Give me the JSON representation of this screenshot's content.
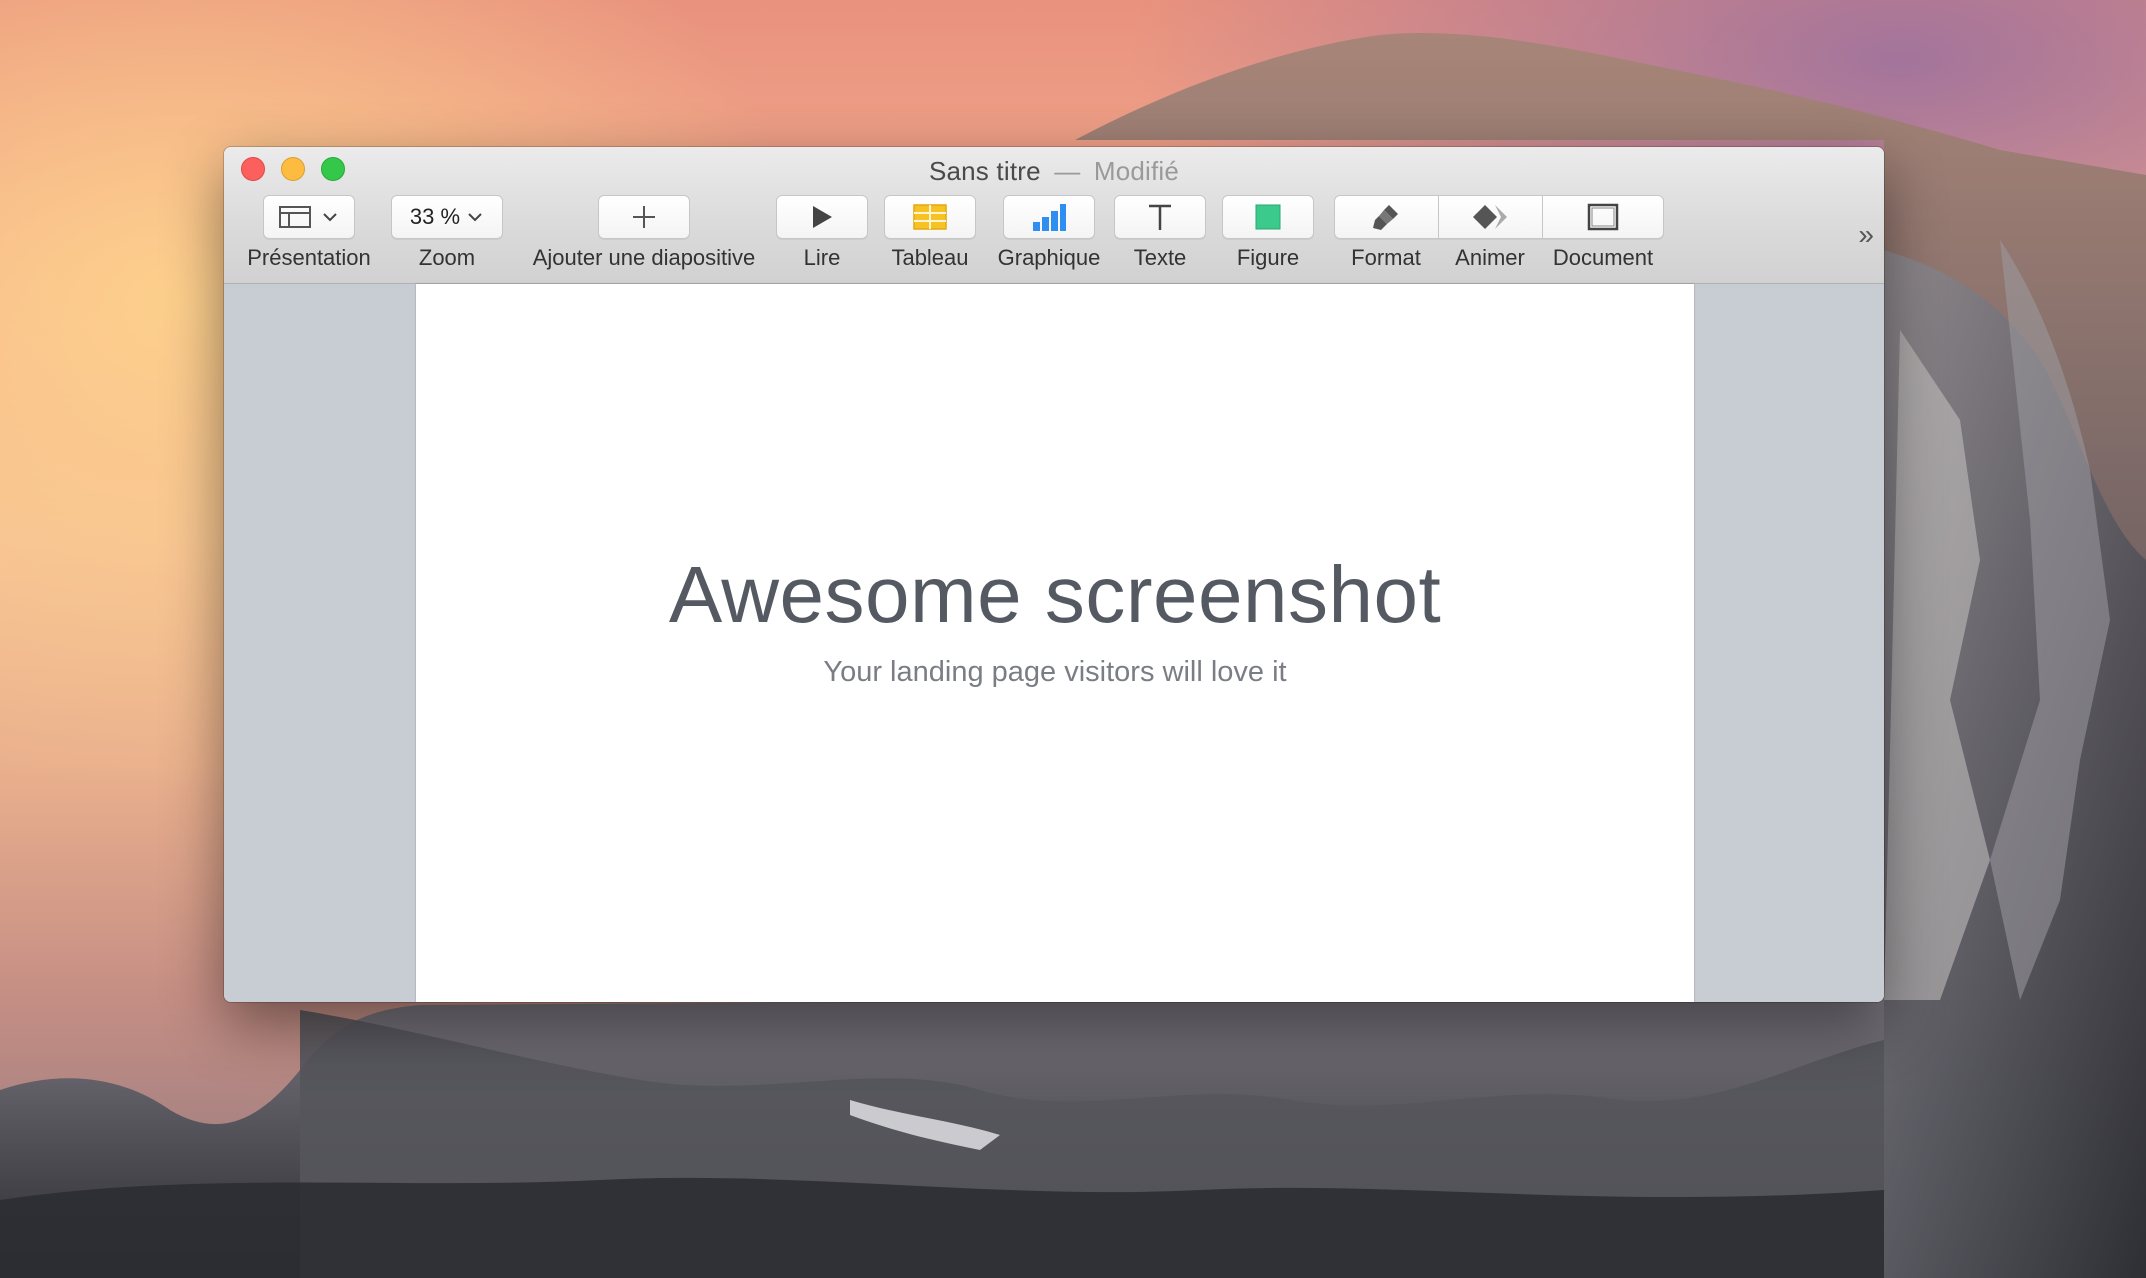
{
  "window": {
    "title": "Sans titre",
    "separator": "—",
    "status": "Modifié"
  },
  "toolbar": {
    "presentation": "Présentation",
    "zoom_label": "Zoom",
    "zoom_value": "33 %",
    "add_slide": "Ajouter une diapositive",
    "play": "Lire",
    "table": "Tableau",
    "chart": "Graphique",
    "text": "Texte",
    "shape": "Figure",
    "format": "Format",
    "animate": "Animer",
    "document": "Document",
    "more": "»"
  },
  "slide": {
    "title": "Awesome screenshot",
    "subtitle": "Your landing page visitors will love it"
  },
  "icons": {
    "presentation": "sidebar-layout-icon",
    "add": "plus-icon",
    "play": "play-icon",
    "table": "table-icon",
    "chart": "bar-chart-icon",
    "text": "text-t-icon",
    "shape": "square-shape-icon",
    "format": "paintbrush-icon",
    "animate": "diamond-animate-icon",
    "document": "document-frame-icon"
  },
  "colors": {
    "close": "#fc605c",
    "minimize": "#fdbc40",
    "maximize": "#34c84a",
    "table_icon": "#f6c226",
    "chart_icon": "#2f8ff0",
    "shape_icon": "#3cc98c"
  }
}
